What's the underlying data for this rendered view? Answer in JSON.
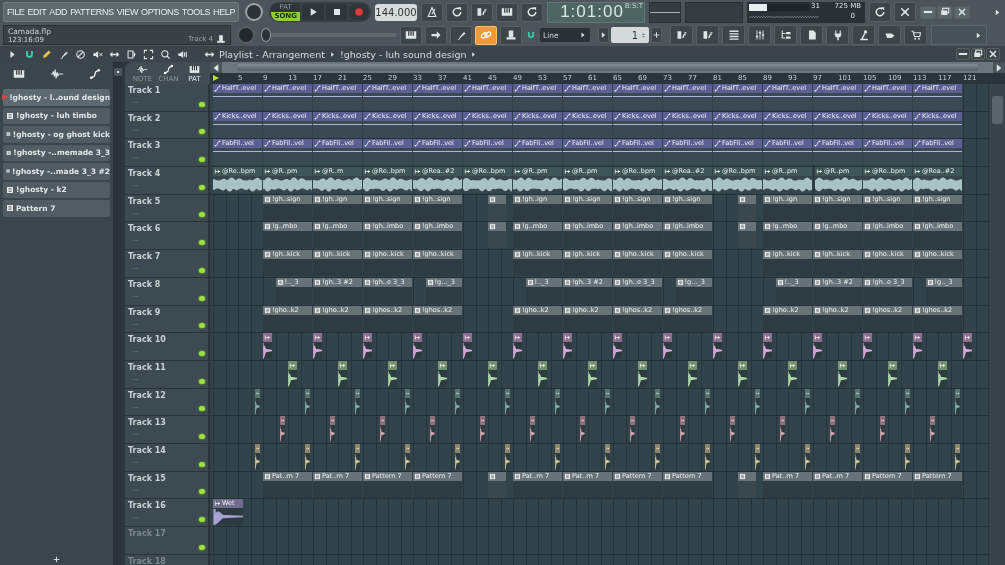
{
  "menu": [
    "FILE",
    "EDIT",
    "ADD",
    "PATTERNS",
    "VIEW",
    "OPTIONS",
    "TOOLS",
    "HELP"
  ],
  "transport": {
    "modes": [
      {
        "label": "PAT",
        "selected": false
      },
      {
        "label": "SONG",
        "selected": true
      }
    ],
    "tempo": "144.000",
    "position": {
      "level": 0
    }
  },
  "file": {
    "name": "Camada.flp",
    "time": "123:16:09",
    "hint": "Track 4"
  },
  "clock": {
    "time": "1:01:00",
    "unit": "B:S:T"
  },
  "monitor": {
    "cpu": "31",
    "level": 0.3,
    "memory": "725 MB",
    "voices": "0"
  },
  "link": {
    "on": true
  },
  "snap": {
    "value": "Line"
  },
  "pattern_number": {
    "value": "1"
  },
  "breadcrumb": [
    "Playlist - Arrangement",
    "!ghosty - luh sound design"
  ],
  "browser": {
    "patterns": [
      {
        "label": "!ghosty - l..ound design",
        "selected": true
      },
      {
        "label": "!ghosty - luh timbo",
        "selected": false
      },
      {
        "label": "!ghosty - og ghost kick",
        "selected": false
      },
      {
        "label": "!ghosty -..memade 3_3",
        "selected": false
      },
      {
        "label": "!ghosty -..made 3_3 #2",
        "selected": false
      },
      {
        "label": "!ghosty - k2",
        "selected": false
      },
      {
        "label": "Pattern 7",
        "selected": false
      }
    ]
  },
  "playlist": {
    "header_tabs": [
      {
        "label": "NOTE",
        "selected": false
      },
      {
        "label": "CHAN",
        "selected": false
      },
      {
        "label": "PAT",
        "selected": true
      }
    ],
    "ruler": [
      "5",
      "9",
      "13",
      "17",
      "21",
      "25",
      "29",
      "33",
      "37",
      "41",
      "45",
      "49",
      "53",
      "57",
      "61",
      "65",
      "69",
      "73",
      "77",
      "81",
      "85",
      "89",
      "93",
      "97",
      "101",
      "105",
      "109",
      "113",
      "117",
      "121"
    ],
    "tracks": [
      {
        "name": "Track 1",
        "menu": "...",
        "on": true,
        "disabled": false,
        "kind": "automation",
        "clips": [
          {
            "label": "HalfT..evel"
          },
          {
            "label": "HalfT..evel"
          },
          {
            "label": "HalfT..evel"
          },
          {
            "label": "HalfT..evel"
          },
          {
            "label": "HalfT..evel"
          },
          {
            "label": "HalfT..evel"
          },
          {
            "label": "HalfT..evel"
          },
          {
            "label": "HalfT..evel"
          },
          {
            "label": "HalfT..evel"
          },
          {
            "label": "HalfT..evel"
          },
          {
            "label": "HalfT..evel"
          },
          {
            "label": "HalfT..evel"
          },
          {
            "label": "HalfT..evel"
          },
          {
            "label": "HalfT..evel"
          },
          {
            "label": "HalfT..evel"
          }
        ]
      },
      {
        "name": "Track 2",
        "menu": "...",
        "on": true,
        "disabled": false,
        "kind": "automation",
        "clips": [
          {
            "label": "Kicks..evel"
          },
          {
            "label": "Kicks..evel"
          },
          {
            "label": "Kicks..evel"
          },
          {
            "label": "Kicks..evel"
          },
          {
            "label": "Kicks..evel"
          },
          {
            "label": "Kicks..evel"
          },
          {
            "label": "Kicks..evel"
          },
          {
            "label": "Kicks..evel"
          },
          {
            "label": "Kicks..evel"
          },
          {
            "label": "Kicks..evel"
          },
          {
            "label": "Kicks..evel"
          },
          {
            "label": "Kicks..evel"
          },
          {
            "label": "Kicks..evel"
          },
          {
            "label": "Kicks..evel"
          },
          {
            "label": "Kicks..evel"
          }
        ]
      },
      {
        "name": "Track 3",
        "menu": "...",
        "on": true,
        "disabled": false,
        "kind": "automation",
        "clips": [
          {
            "label": "FabFil..vel"
          },
          {
            "label": "FabFil..vel"
          },
          {
            "label": "FabFil..vel"
          },
          {
            "label": "FabFil..vel"
          },
          {
            "label": "FabFil..vel"
          },
          {
            "label": "FabFil..vel"
          },
          {
            "label": "FabFil..vel"
          },
          {
            "label": "FabFil..vel"
          },
          {
            "label": "FabFil..vel"
          },
          {
            "label": "FabFil..vel"
          },
          {
            "label": "FabFil..vel"
          },
          {
            "label": "FabFil..vel"
          },
          {
            "label": "FabFil..vel"
          },
          {
            "label": "FabFil..vel"
          },
          {
            "label": "FabFil..vel"
          }
        ]
      },
      {
        "name": "Track 4",
        "menu": "...",
        "on": true,
        "disabled": false,
        "kind": "audio",
        "clips": [
          {
            "label": "@Re..bpm"
          },
          {
            "label": "@R..pm"
          },
          {
            "label": "@R..m"
          },
          {
            "label": "@Re..bpm"
          },
          {
            "label": "@Rea..#2"
          },
          {
            "label": "@Re..bpm"
          },
          {
            "label": "@R..pm"
          },
          {
            "label": "@R..pm"
          },
          {
            "label": "@Re..bpm"
          },
          {
            "label": "@Rea..#2"
          },
          {
            "label": "@Re..bpm"
          },
          {
            "label": "@R..pm"
          },
          {
            "label": "@R..pm"
          },
          {
            "label": "@Re..bpm"
          },
          {
            "label": "@Rea..#2"
          }
        ]
      },
      {
        "name": "Track 5",
        "menu": "...",
        "on": true,
        "disabled": false,
        "kind": "pattern",
        "clips": [
          {
            "kind": "full",
            "label": "!gh..sign"
          },
          {
            "kind": "full",
            "label": "!gh..ign"
          },
          {
            "kind": "full",
            "label": "!gh..sign"
          },
          {
            "kind": "full",
            "label": "!gh..sign"
          },
          {
            "kind": "stub"
          },
          {
            "kind": "full",
            "label": "!gh..ign"
          },
          {
            "kind": "full",
            "label": "!gh..sign"
          },
          {
            "kind": "full",
            "label": "!gh..sign"
          },
          {
            "kind": "full",
            "label": "!gh..sign"
          },
          {
            "kind": "stub"
          },
          {
            "kind": "full",
            "label": "!gh..ign"
          },
          {
            "kind": "full",
            "label": "!gh..sign"
          },
          {
            "kind": "full",
            "label": "!gh..sign"
          },
          {
            "kind": "full",
            "label": "!gh..sign"
          }
        ]
      },
      {
        "name": "Track 6",
        "menu": "...",
        "on": true,
        "disabled": false,
        "kind": "pattern",
        "clips": [
          {
            "kind": "full",
            "label": "!g..mbo"
          },
          {
            "kind": "full",
            "label": "!g..mbo"
          },
          {
            "kind": "full",
            "label": "!gh..imbo"
          },
          {
            "kind": "full",
            "label": "!gh..imbo"
          },
          {
            "kind": "stub"
          },
          {
            "kind": "full",
            "label": "!g..mbo"
          },
          {
            "kind": "full",
            "label": "!gh..imbo"
          },
          {
            "kind": "full",
            "label": "!gh..imbo"
          },
          {
            "kind": "full",
            "label": "!gh..imbo"
          },
          {
            "kind": "stub"
          },
          {
            "kind": "full",
            "label": "!g..mbo"
          },
          {
            "kind": "full",
            "label": "!g..mbo"
          },
          {
            "kind": "full",
            "label": "!gh..imbo"
          },
          {
            "kind": "full",
            "label": "!gh..imbo"
          }
        ]
      },
      {
        "name": "Track 7",
        "menu": "...",
        "on": true,
        "disabled": false,
        "kind": "pattern",
        "clips": [
          {
            "kind": "full",
            "label": "!gh..kick"
          },
          {
            "kind": "full",
            "label": "!gh..kick"
          },
          {
            "kind": "full",
            "label": "!gho..kick"
          },
          {
            "kind": "full",
            "label": "!gho..kick"
          },
          {
            "kind": "full",
            "label": "!gh..kick"
          },
          {
            "kind": "full",
            "label": "!gh..kick"
          },
          {
            "kind": "full",
            "label": "!gho..kick"
          },
          {
            "kind": "full",
            "label": "!gho..kick"
          },
          {
            "kind": "full",
            "label": "!gh..kick"
          },
          {
            "kind": "full",
            "label": "!gh..kick"
          },
          {
            "kind": "full",
            "label": "!gho..kick"
          },
          {
            "kind": "full",
            "label": "!gho..kick"
          }
        ]
      },
      {
        "name": "Track 8",
        "menu": "...",
        "on": true,
        "disabled": false,
        "kind": "pattern",
        "clips": [
          {
            "kind": "full",
            "label": "!.._3"
          },
          {
            "kind": "full",
            "label": "!gh..3 #2"
          },
          {
            "kind": "full",
            "label": "!gh..e 3_3"
          },
          {
            "kind": "full",
            "label": "!g..._3"
          },
          {
            "kind": "full",
            "label": "!.._3"
          },
          {
            "kind": "full",
            "label": "!gh..3 #2"
          },
          {
            "kind": "full",
            "label": "!gh..e 3_3"
          },
          {
            "kind": "full",
            "label": "!g..._3"
          },
          {
            "kind": "full",
            "label": "!.._3"
          },
          {
            "kind": "full",
            "label": "!gh..3 #2"
          },
          {
            "kind": "full",
            "label": "!gh..e 3_3"
          },
          {
            "kind": "full",
            "label": "!g.._3"
          }
        ]
      },
      {
        "name": "Track 9",
        "menu": "...",
        "on": true,
        "disabled": false,
        "kind": "pattern",
        "clips": [
          {
            "kind": "full",
            "label": "!gho..k2"
          },
          {
            "kind": "full",
            "label": "!gho..k2"
          },
          {
            "kind": "full",
            "label": "!ghos..k2"
          },
          {
            "kind": "full",
            "label": "!ghos..k2"
          },
          {
            "kind": "full",
            "label": "!gho..k2"
          },
          {
            "kind": "full",
            "label": "!gho..k2"
          },
          {
            "kind": "full",
            "label": "!ghos..k2"
          },
          {
            "kind": "full",
            "label": "!ghos..k2"
          },
          {
            "kind": "full",
            "label": "!gho..k2"
          },
          {
            "kind": "full",
            "label": "!gho..k2"
          },
          {
            "kind": "full",
            "label": "!ghos..k2"
          },
          {
            "kind": "full",
            "label": "!ghos..k2"
          }
        ]
      },
      {
        "name": "Track 10",
        "menu": "...",
        "on": true,
        "disabled": false,
        "kind": "sample",
        "color": "#8e6f8f"
      },
      {
        "name": "Track 11",
        "menu": "...",
        "on": true,
        "disabled": false,
        "kind": "sample",
        "color": "#73906f"
      },
      {
        "name": "Track 12",
        "menu": "...",
        "on": true,
        "disabled": false,
        "kind": "sample",
        "color": "#567572"
      },
      {
        "name": "Track 13",
        "menu": "...",
        "on": true,
        "disabled": false,
        "kind": "sample",
        "color": "#8f7078"
      },
      {
        "name": "Track 14",
        "menu": "...",
        "on": true,
        "disabled": false,
        "kind": "sample",
        "color": "#8a876a"
      },
      {
        "name": "Track 15",
        "menu": "...",
        "on": true,
        "disabled": false,
        "kind": "pattern",
        "clips": [
          {
            "kind": "full",
            "label": "Pat..rn 7"
          },
          {
            "kind": "full",
            "label": "Pat..rn 7"
          },
          {
            "kind": "full",
            "label": "Pattern 7"
          },
          {
            "kind": "full",
            "label": "Pattern 7"
          },
          {
            "kind": "stub"
          },
          {
            "kind": "full",
            "label": "Pat..rn 7"
          },
          {
            "kind": "full",
            "label": "Pat..rn 7"
          },
          {
            "kind": "full",
            "label": "Pattern 7"
          },
          {
            "kind": "full",
            "label": "Pattern 7"
          },
          {
            "kind": "stub"
          },
          {
            "kind": "full",
            "label": "Pat..rn 7"
          },
          {
            "kind": "full",
            "label": "Pat..rn 7"
          },
          {
            "kind": "full",
            "label": "Pattern 7"
          },
          {
            "kind": "full",
            "label": "Pattern 7"
          }
        ]
      },
      {
        "name": "Track 16",
        "menu": "...",
        "on": true,
        "disabled": false,
        "kind": "sample",
        "color": "#6f6c8c",
        "clips": [
          {
            "label": "Wet"
          }
        ]
      },
      {
        "name": "Track 17",
        "on": true,
        "disabled": true,
        "kind": "empty"
      },
      {
        "name": "Track 18",
        "disabled": true,
        "kind": "empty"
      }
    ]
  }
}
